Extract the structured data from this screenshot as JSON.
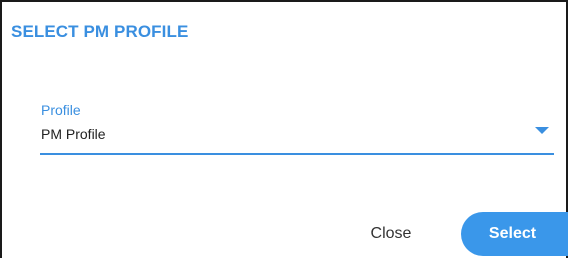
{
  "dialog": {
    "title": "SELECT PM PROFILE"
  },
  "profile_field": {
    "label": "Profile",
    "value": "PM Profile",
    "dropdown_icon": "caret-down-icon"
  },
  "actions": {
    "close_label": "Close",
    "select_label": "Select"
  },
  "colors": {
    "accent": "#3a8fe0",
    "primary_button": "#3a97ea",
    "text": "#222222",
    "border": "#1a1a1a"
  }
}
